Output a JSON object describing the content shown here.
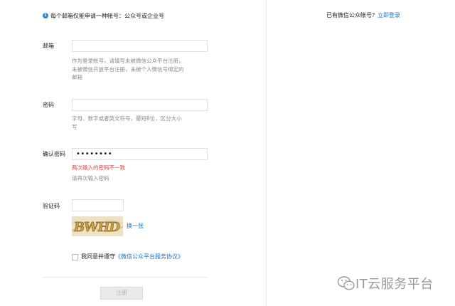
{
  "notice": {
    "text": "每个邮箱仅能申请一种帐号：公众号或企业号"
  },
  "login_hint": {
    "text": "已有微信公众帐号？",
    "link": "立即登录"
  },
  "email": {
    "label": "邮箱",
    "value": "",
    "hint_lines": [
      "作为登录帐号，请填写未被微信公众平台注册，",
      "未被微信开放平台注册，未被个人微信号绑定的",
      "邮箱"
    ]
  },
  "password": {
    "label": "密码",
    "value": "",
    "hint_lines": [
      "字母、数字或者英文符号，最短8位，区分大小",
      "写"
    ]
  },
  "confirm_password": {
    "label": "确认密码",
    "value": "••••••••",
    "error": "两次输入的密码不一致",
    "hint": "请再次输入密码"
  },
  "captcha": {
    "label": "验证码",
    "value": "",
    "image_text": "BWHD",
    "refresh": "换一张"
  },
  "agreement": {
    "prefix": "我同意并遵守",
    "link": "《微信公众平台服务协议》",
    "checked": false
  },
  "submit": {
    "label": "注册"
  },
  "watermark": {
    "text": "IT云服务平台",
    "icon": "wechat-icon"
  }
}
